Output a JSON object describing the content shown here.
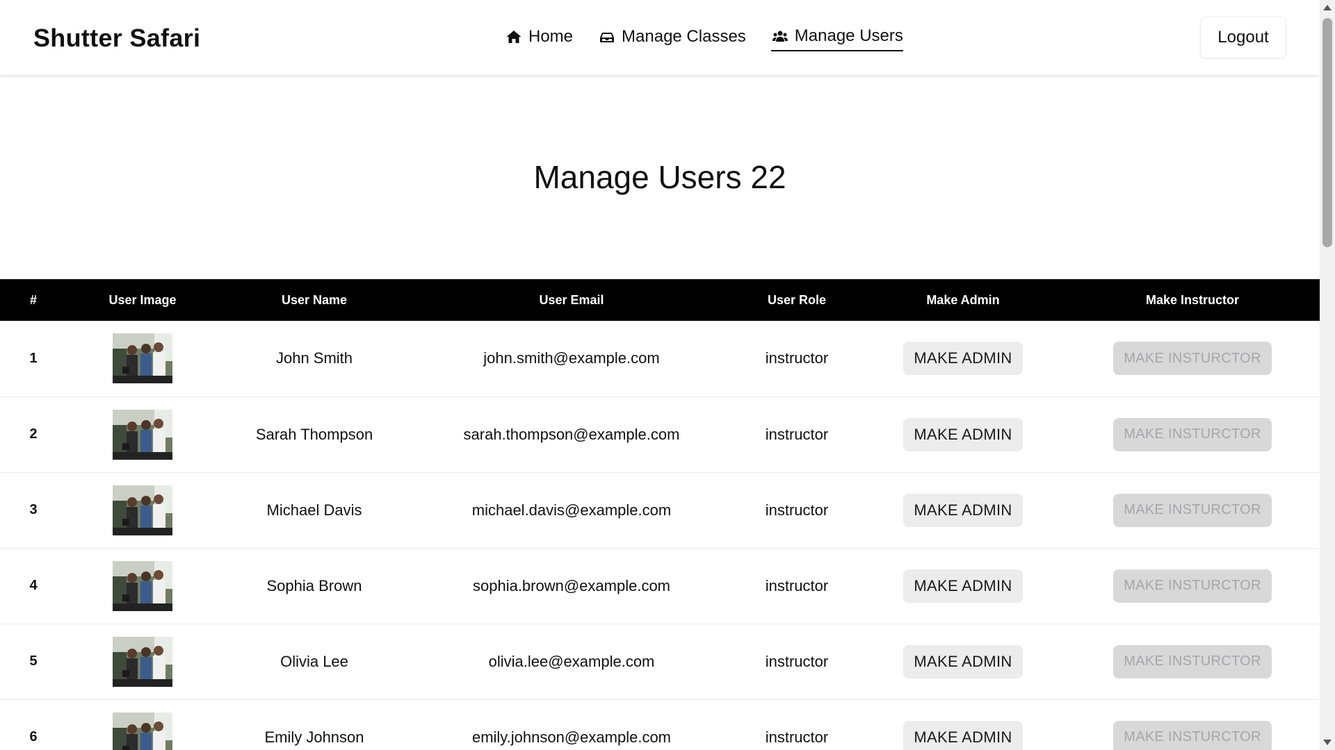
{
  "navbar": {
    "brand": "Shutter Safari",
    "links": [
      {
        "label": "Home",
        "icon": "home-icon",
        "active": false
      },
      {
        "label": "Manage Classes",
        "icon": "classes-icon",
        "active": false
      },
      {
        "label": "Manage Users",
        "icon": "users-icon",
        "active": true
      }
    ],
    "logout_label": "Logout"
  },
  "page": {
    "title": "Manage Users 22"
  },
  "table": {
    "headers": [
      "#",
      "User Image",
      "User Name",
      "User Email",
      "User Role",
      "Make Admin",
      "Make Instructor"
    ],
    "rows": [
      {
        "num": "1",
        "name": "John Smith",
        "email": "john.smith@example.com",
        "role": "instructor",
        "admin_label": "MAKE ADMIN",
        "instructor_label": "MAKE INSTURCTOR"
      },
      {
        "num": "2",
        "name": "Sarah Thompson",
        "email": "sarah.thompson@example.com",
        "role": "instructor",
        "admin_label": "MAKE ADMIN",
        "instructor_label": "MAKE INSTURCTOR"
      },
      {
        "num": "3",
        "name": "Michael Davis",
        "email": "michael.davis@example.com",
        "role": "instructor",
        "admin_label": "MAKE ADMIN",
        "instructor_label": "MAKE INSTURCTOR"
      },
      {
        "num": "4",
        "name": "Sophia Brown",
        "email": "sophia.brown@example.com",
        "role": "instructor",
        "admin_label": "MAKE ADMIN",
        "instructor_label": "MAKE INSTURCTOR"
      },
      {
        "num": "5",
        "name": "Olivia Lee",
        "email": "olivia.lee@example.com",
        "role": "instructor",
        "admin_label": "MAKE ADMIN",
        "instructor_label": "MAKE INSTURCTOR"
      },
      {
        "num": "6",
        "name": "Emily Johnson",
        "email": "emily.johnson@example.com",
        "role": "instructor",
        "admin_label": "MAKE ADMIN",
        "instructor_label": "MAKE INSTURCTOR"
      }
    ]
  },
  "colors": {
    "header_bg": "#000000",
    "admin_button_bg": "#ececec",
    "instructor_button_disabled_bg": "#d8d8d9"
  }
}
